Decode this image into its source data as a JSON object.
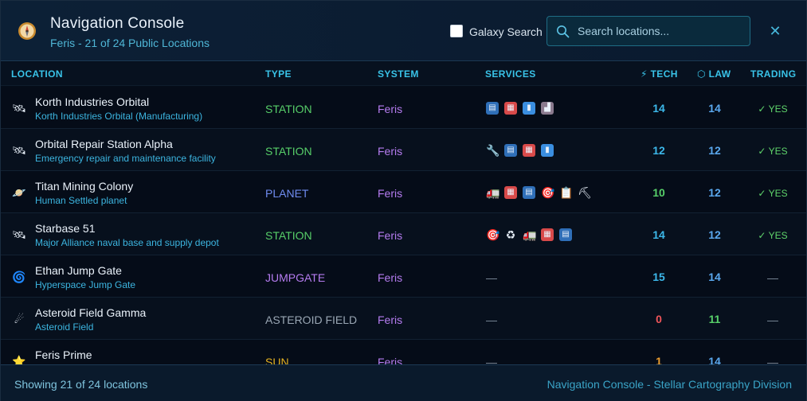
{
  "header": {
    "title": "Navigation Console",
    "subtitle": "Feris - 21 of 24 Public Locations",
    "galaxy_search_label": "Galaxy Search",
    "galaxy_search_checked": false,
    "search_placeholder": "Search locations...",
    "search_value": "",
    "close_label": "✕"
  },
  "columns": {
    "location": "LOCATION",
    "type": "TYPE",
    "system": "SYSTEM",
    "services": "SERVICES",
    "tech": "TECH",
    "law": "LAW",
    "trading": "TRADING"
  },
  "rows": [
    {
      "icon": "satellite-icon",
      "icon_glyph": "🛰",
      "name": "Korth Industries Orbital",
      "desc": "Korth Industries Orbital (Manufacturing)",
      "type": "STATION",
      "type_color": "#57cf69",
      "system": "Feris",
      "services": [
        "bank-icon",
        "shop-icon",
        "refuel-icon",
        "factory-icon"
      ],
      "tech": "14",
      "tech_color": "#3cb8ea",
      "law": "14",
      "law_color": "#5aa8ee",
      "trading": "✓ YES"
    },
    {
      "icon": "satellite-icon",
      "icon_glyph": "🛰",
      "name": "Orbital Repair Station Alpha",
      "desc": "Emergency repair and maintenance facility",
      "type": "STATION",
      "type_color": "#57cf69",
      "system": "Feris",
      "services": [
        "wrench-icon",
        "bank-icon",
        "shop-icon",
        "refuel-icon"
      ],
      "tech": "12",
      "tech_color": "#3cb8ea",
      "law": "12",
      "law_color": "#5aa8ee",
      "trading": "✓ YES"
    },
    {
      "icon": "planet-icon",
      "icon_glyph": "🪐",
      "name": "Titan Mining Colony",
      "desc": "Human Settled planet",
      "type": "PLANET",
      "type_color": "#6f8cf0",
      "system": "Feris",
      "services": [
        "truck-icon",
        "shop-icon",
        "bank-icon",
        "target-icon",
        "clipboard-icon",
        "pickaxe-icon"
      ],
      "tech": "10",
      "tech_color": "#57cf69",
      "law": "12",
      "law_color": "#5aa8ee",
      "trading": "✓ YES"
    },
    {
      "icon": "satellite-icon",
      "icon_glyph": "🛰",
      "name": "Starbase 51",
      "desc": "Major Alliance naval base and supply depot",
      "type": "STATION",
      "type_color": "#57cf69",
      "system": "Feris",
      "services": [
        "target-icon",
        "recycle-icon",
        "truck-icon",
        "shop-icon",
        "bank-icon"
      ],
      "tech": "14",
      "tech_color": "#3cb8ea",
      "law": "12",
      "law_color": "#5aa8ee",
      "trading": "✓ YES"
    },
    {
      "icon": "vortex-icon",
      "icon_glyph": "🌀",
      "name": "Ethan Jump Gate",
      "desc": "Hyperspace Jump Gate",
      "type": "JUMPGATE",
      "type_color": "#b57cf0",
      "system": "Feris",
      "services": [],
      "tech": "15",
      "tech_color": "#3cb8ea",
      "law": "14",
      "law_color": "#5aa8ee",
      "trading": "—"
    },
    {
      "icon": "comet-icon",
      "icon_glyph": "☄",
      "name": "Asteroid Field Gamma",
      "desc": "Asteroid Field",
      "type": "ASTEROID FIELD",
      "type_color": "#9aa7b4",
      "system": "Feris",
      "services": [],
      "tech": "0",
      "tech_color": "#f0555a",
      "law": "11",
      "law_color": "#57cf69",
      "trading": "—"
    },
    {
      "icon": "star-icon",
      "icon_glyph": "⭐",
      "name": "Feris Prime",
      "desc": "",
      "type": "SUN",
      "type_color": "#e6b320",
      "system": "Feris",
      "services": [],
      "tech": "1",
      "tech_color": "#f0a030",
      "law": "14",
      "law_color": "#5aa8ee",
      "trading": "—"
    }
  ],
  "empty_services": "—",
  "footer": {
    "count": "Showing 21 of 24 locations",
    "credit": "Navigation Console - Stellar Cartography Division"
  }
}
